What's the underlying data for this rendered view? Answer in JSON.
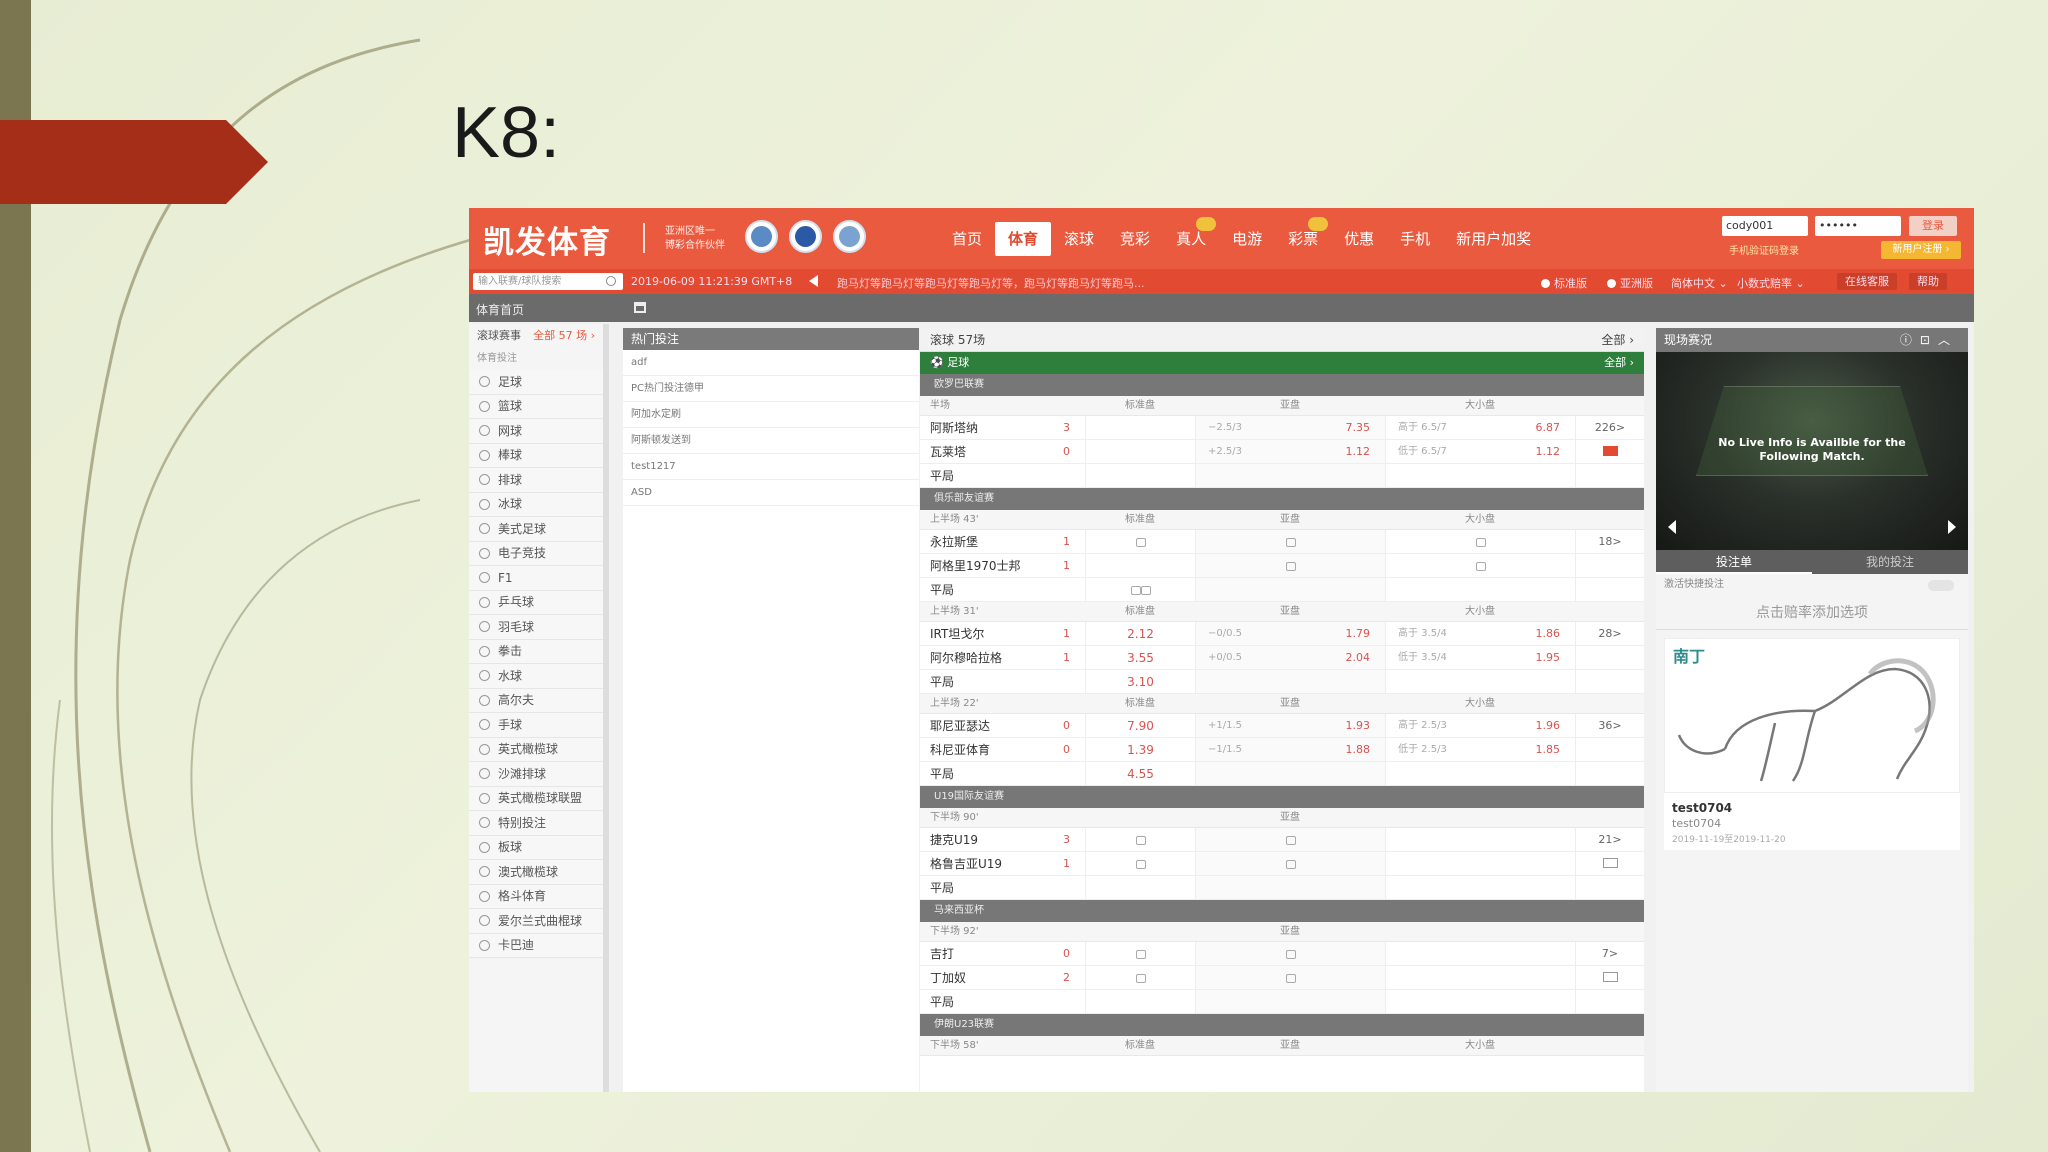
{
  "slide": {
    "title": "K8:"
  },
  "header": {
    "logo": "凯发体育",
    "partner": [
      "亚洲区唯一",
      "博彩合作伙伴"
    ],
    "nav": [
      {
        "label": "首页",
        "active": false,
        "badge": false
      },
      {
        "label": "体育",
        "active": true,
        "badge": false
      },
      {
        "label": "滚球",
        "active": false,
        "badge": false
      },
      {
        "label": "竞彩",
        "active": false,
        "badge": false
      },
      {
        "label": "真人",
        "active": false,
        "badge": true
      },
      {
        "label": "电游",
        "active": false,
        "badge": false
      },
      {
        "label": "彩票",
        "active": false,
        "badge": true
      },
      {
        "label": "优惠",
        "active": false,
        "badge": false
      },
      {
        "label": "手机",
        "active": false,
        "badge": false
      },
      {
        "label": "新用户加奖",
        "active": false,
        "badge": false
      }
    ],
    "username": "cody001",
    "password": "••••••",
    "login_label": "登录",
    "forgot_label": "手机验证码登录",
    "register_label": "新用户注册 ›"
  },
  "subbar": {
    "search_placeholder": "输入联赛/球队搜索",
    "time": "2019-06-09 11:21:39 GMT+8",
    "marquee": "跑马灯等跑马灯等跑马灯等跑马灯等，跑马灯等跑马灯等跑马...",
    "opt_standard": "标准版",
    "opt_asian": "亚洲版",
    "lang": "简体中文 ⌄",
    "odds_fmt": "小数式赔率 ⌄",
    "service": "在线客服",
    "help": "帮助"
  },
  "crumb": {
    "title": "体育首页"
  },
  "sidebar": {
    "live_label": "滚球赛事",
    "live_count": "全部 57 场 ›",
    "sub_label": "体育投注",
    "sports": [
      "足球",
      "篮球",
      "网球",
      "棒球",
      "排球",
      "冰球",
      "美式足球",
      "电子竞技",
      "F1",
      "乒乓球",
      "羽毛球",
      "拳击",
      "水球",
      "高尔夫",
      "手球",
      "英式橄榄球",
      "沙滩排球",
      "英式橄榄球联盟",
      "特别投注",
      "板球",
      "澳式橄榄球",
      "格斗体育",
      "爱尔兰式曲棍球",
      "卡巴迪"
    ]
  },
  "hot": {
    "title": "热门投注",
    "items": [
      "adf",
      "PC热门投注德甲",
      "阿加水定刷",
      "阿斯顿发送到",
      "test1217",
      "ASD"
    ]
  },
  "live": {
    "title": "滚球 57场",
    "all": "全部 ›",
    "sport": "足球",
    "sport_all": "全部 ›",
    "col_full": "标准盘",
    "col_hdp": "亚盘",
    "col_ou": "大小盘",
    "draw": "平局",
    "leagues": [
      {
        "name": "欧罗巴联赛",
        "period": "半场",
        "home": {
          "team": "阿斯塔纳",
          "score": "3",
          "x12": "",
          "hdp": "−2.5/3",
          "hdp_odds": "7.35",
          "ou": "高于 6.5/7",
          "ou_odds": "6.87"
        },
        "away": {
          "team": "瓦莱塔",
          "score": "0",
          "x12": "",
          "hdp": "+2.5/3",
          "hdp_odds": "1.12",
          "ou": "低于 6.5/7",
          "ou_odds": "1.12"
        },
        "draw_x12": "",
        "more": "226>",
        "lock": false
      },
      {
        "name": "俱乐部友谊赛",
        "period": "上半场 43'",
        "home": {
          "team": "永拉斯堡",
          "score": "1"
        },
        "away": {
          "team": "阿格里1970士邦",
          "score": "1"
        },
        "more": "18>",
        "lock": true
      },
      {
        "name": "",
        "period": "上半场 31'",
        "home": {
          "team": "IRT坦戈尔",
          "score": "1",
          "x12": "2.12",
          "hdp": "−0/0.5",
          "hdp_odds": "1.79",
          "ou": "高于 3.5/4",
          "ou_odds": "1.86"
        },
        "away": {
          "team": "阿尔穆哈拉格",
          "score": "1",
          "x12": "3.55",
          "hdp": "+0/0.5",
          "hdp_odds": "2.04",
          "ou": "低于 3.5/4",
          "ou_odds": "1.95"
        },
        "draw_x12": "3.10",
        "more": "28>",
        "lock": false
      },
      {
        "name": "",
        "period": "上半场 22'",
        "home": {
          "team": "耶尼亚瑟达",
          "score": "0",
          "x12": "7.90",
          "hdp": "+1/1.5",
          "hdp_odds": "1.93",
          "ou": "高于 2.5/3",
          "ou_odds": "1.96"
        },
        "away": {
          "team": "科尼亚体育",
          "score": "0",
          "x12": "1.39",
          "hdp": "−1/1.5",
          "hdp_odds": "1.88",
          "ou": "低于 2.5/3",
          "ou_odds": "1.85"
        },
        "draw_x12": "4.55",
        "more": "36>",
        "lock": false
      },
      {
        "name": "U19国际友谊赛",
        "period": "下半场 90'",
        "home": {
          "team": "捷克U19",
          "score": "3"
        },
        "away": {
          "team": "格鲁吉亚U19",
          "score": "1"
        },
        "more": "21>",
        "lock": true
      },
      {
        "name": "马来西亚杯",
        "period": "下半场 92'",
        "home": {
          "team": "吉打",
          "score": "0"
        },
        "away": {
          "team": "丁加奴",
          "score": "2"
        },
        "more": "7>",
        "lock": true
      },
      {
        "name": "伊朗U23联赛",
        "period": "下半场 58'",
        "home": {
          "team": "",
          "score": ""
        },
        "away": {
          "team": "",
          "score": ""
        },
        "more": "",
        "lock": false
      }
    ]
  },
  "right": {
    "title": "现场赛况",
    "no_live": "No Live Info is Availble for the Following Match.",
    "tab_slip": "投注单",
    "tab_mybets": "我的投注",
    "quick_bet": "激活快捷投注",
    "add_selection": "点击赔率添加选项",
    "card_tag": "南丁",
    "card_name": "test0704",
    "card_sub": "test0704",
    "card_time": "2019-11-19至2019-11-20"
  }
}
